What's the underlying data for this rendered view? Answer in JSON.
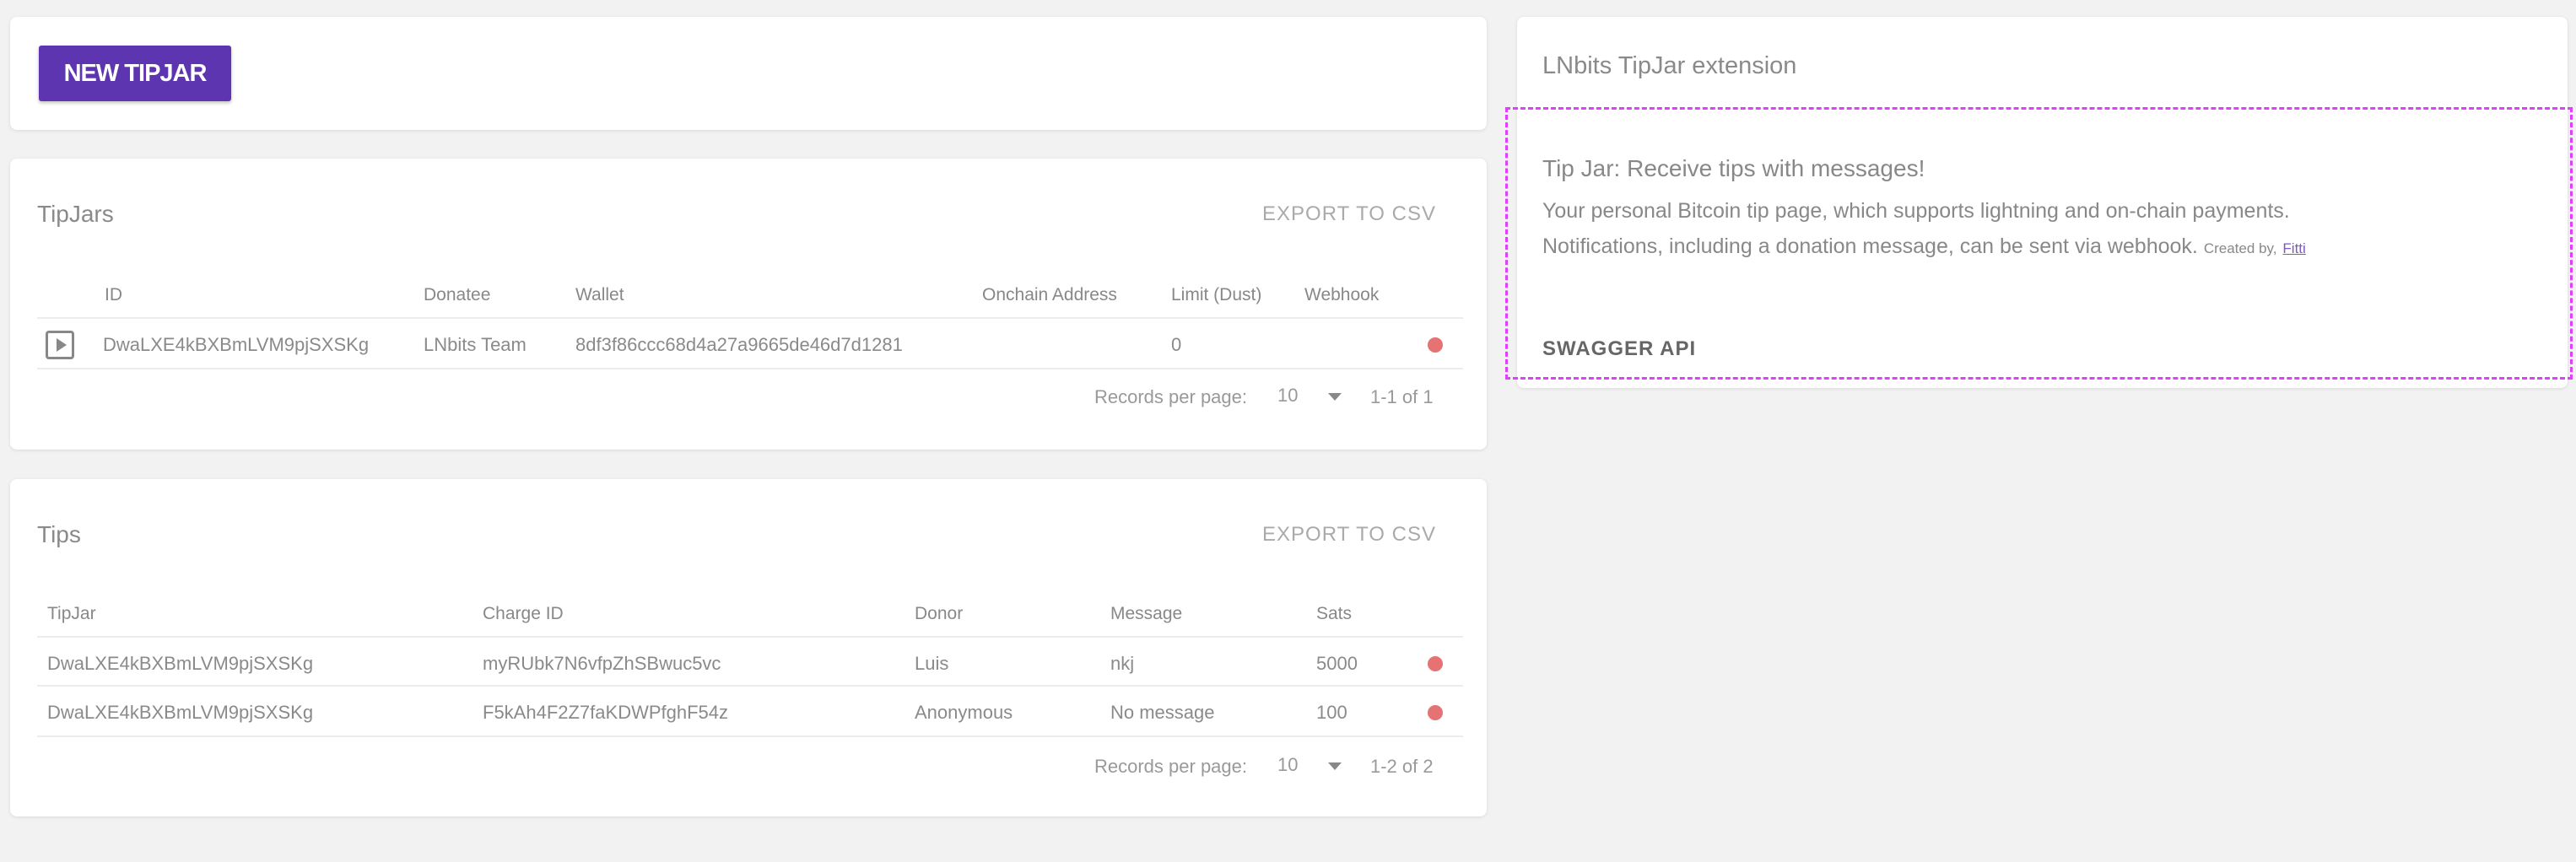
{
  "actions": {
    "new_tipjar_label": "NEW TIPJAR"
  },
  "tipjars": {
    "title": "TipJars",
    "export_label": "EXPORT TO CSV",
    "headers": [
      "ID",
      "Donatee",
      "Wallet",
      "Onchain Address",
      "Limit (Dust)",
      "Webhook"
    ],
    "rows": [
      {
        "id": "DwaLXE4kBXBmLVM9pjSXSKg",
        "donatee": "LNbits Team",
        "wallet": "8df3f86ccc68d4a27a9665de46d7d1281",
        "onchain": "",
        "limit": "0",
        "webhook": ""
      }
    ],
    "footer": {
      "records_label": "Records per page:",
      "per_page": "10",
      "range": "1-1 of 1"
    }
  },
  "tips": {
    "title": "Tips",
    "export_label": "EXPORT TO CSV",
    "headers": [
      "TipJar",
      "Charge ID",
      "Donor",
      "Message",
      "Sats"
    ],
    "rows": [
      {
        "tipjar": "DwaLXE4kBXBmLVM9pjSXSKg",
        "charge_id": "myRUbk7N6vfpZhSBwuc5vc",
        "donor": "Luis",
        "message": "nkj",
        "sats": "5000"
      },
      {
        "tipjar": "DwaLXE4kBXBmLVM9pjSXSKg",
        "charge_id": "F5kAh4F2Z7faKDWPfghF54z",
        "donor": "Anonymous",
        "message": "No message",
        "sats": "100"
      }
    ],
    "footer": {
      "records_label": "Records per page:",
      "per_page": "10",
      "range": "1-2 of 2"
    }
  },
  "info": {
    "title": "LNbits TipJar extension",
    "heading": "Tip Jar: Receive tips with messages!",
    "line1": "Your personal Bitcoin tip page, which supports lightning and on-chain payments.",
    "line2": "Notifications, including a donation message, can be sent via webhook.",
    "created_by": "Created by,",
    "author": "Fitti",
    "swagger_label": "SWAGGER API"
  },
  "colors": {
    "accent": "#5e35b1",
    "delete": "#e57373",
    "highlight_border": "#e040fb"
  }
}
